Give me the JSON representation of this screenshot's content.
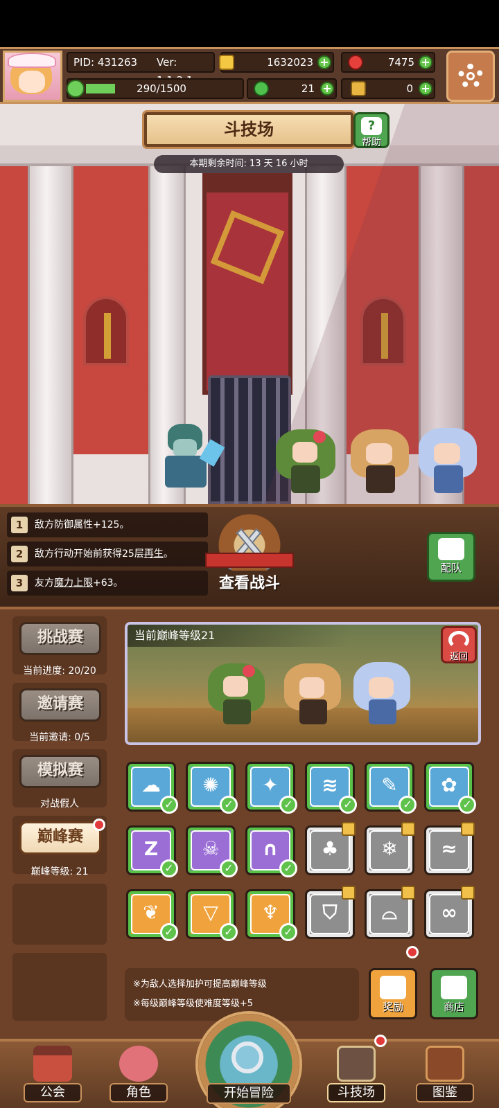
{
  "player": {
    "pid": "PID: 431263",
    "version": "Ver: 1.1.2.1",
    "xp": "290/1500",
    "xp_fraction": 0.19
  },
  "currencies": {
    "gold": "1632023",
    "gems": "7475",
    "clover": "21",
    "keys": "0"
  },
  "arena": {
    "title": "斗技场",
    "help_label": "帮助",
    "timer": "本期剩余时间: 13 天 16 小时"
  },
  "modifiers": [
    {
      "num": "1",
      "pre": "敌方防御属性+125。",
      "link": "",
      "post": ""
    },
    {
      "num": "2",
      "pre": "敌方行动开始前获得25层",
      "link": "再生",
      "post": "。"
    },
    {
      "num": "3",
      "pre": "友方",
      "link": "魔力上限",
      "post": "+63。"
    }
  ],
  "battle": {
    "view_label": "查看战斗",
    "team_label": "配队"
  },
  "modes": [
    {
      "label": "挑战赛",
      "sub": "当前进度: 20/20"
    },
    {
      "label": "邀请赛",
      "sub": "当前邀请: 0/5"
    },
    {
      "label": "模拟赛",
      "sub": "对战假人"
    },
    {
      "label": "巅峰赛",
      "sub": "巅峰等级: 21"
    }
  ],
  "peak": {
    "title": "当前巅峰等级21",
    "back_label": "返回"
  },
  "mod_icons": [
    {
      "icon": "cloud-icon",
      "glyph": "☁",
      "color": "blue",
      "state": "checked"
    },
    {
      "icon": "sun-icon",
      "glyph": "✺",
      "color": "blue",
      "state": "checked"
    },
    {
      "icon": "sparkle-icon",
      "glyph": "✦",
      "color": "blue",
      "state": "checked"
    },
    {
      "icon": "tornado-icon",
      "glyph": "≋",
      "color": "blue",
      "state": "checked"
    },
    {
      "icon": "feather-icon",
      "glyph": "✎",
      "color": "blue",
      "state": "checked"
    },
    {
      "icon": "paw-icon",
      "glyph": "✿",
      "color": "blue",
      "state": "checked"
    },
    {
      "icon": "sleep-icon",
      "glyph": "Z",
      "color": "purple",
      "state": "checked"
    },
    {
      "icon": "skull-icon",
      "glyph": "☠",
      "color": "purple",
      "state": "checked"
    },
    {
      "icon": "tombstone-icon",
      "glyph": "∩",
      "color": "purple",
      "state": "checked"
    },
    {
      "icon": "tree-icon",
      "glyph": "♣",
      "color": "gray",
      "state": "locked"
    },
    {
      "icon": "snowflake-icon",
      "glyph": "❄",
      "color": "gray",
      "state": "locked"
    },
    {
      "icon": "wind-icon",
      "glyph": "≈",
      "color": "gray",
      "state": "locked"
    },
    {
      "icon": "shell-icon",
      "glyph": "❦",
      "color": "orange",
      "state": "checked"
    },
    {
      "icon": "triangle-gem-icon",
      "glyph": "▽",
      "color": "orange",
      "state": "checked"
    },
    {
      "icon": "claw-icon",
      "glyph": "♆",
      "color": "orange",
      "state": "checked"
    },
    {
      "icon": "shield-icon",
      "glyph": "⛉",
      "color": "gray",
      "state": "locked"
    },
    {
      "icon": "arch-icon",
      "glyph": "⌓",
      "color": "gray",
      "state": "locked"
    },
    {
      "icon": "infinity-icon",
      "glyph": "∞",
      "color": "gray",
      "state": "locked"
    }
  ],
  "tips": [
    "※为敌人选择加护可提高巅峰等级",
    "※每级巅峰等级使难度等级+5"
  ],
  "tools": {
    "reward_label": "奖励",
    "shop_label": "商店"
  },
  "nav": {
    "guild": "公会",
    "character": "角色",
    "adventure": "开始冒险",
    "arena": "斗技场",
    "codex": "图鉴"
  },
  "colors": {
    "blue": "#5aa8d8",
    "purple": "#9b6ed6",
    "orange": "#f0a33c",
    "gray": "#8e8e8e",
    "check_green": "#5fc24a"
  }
}
